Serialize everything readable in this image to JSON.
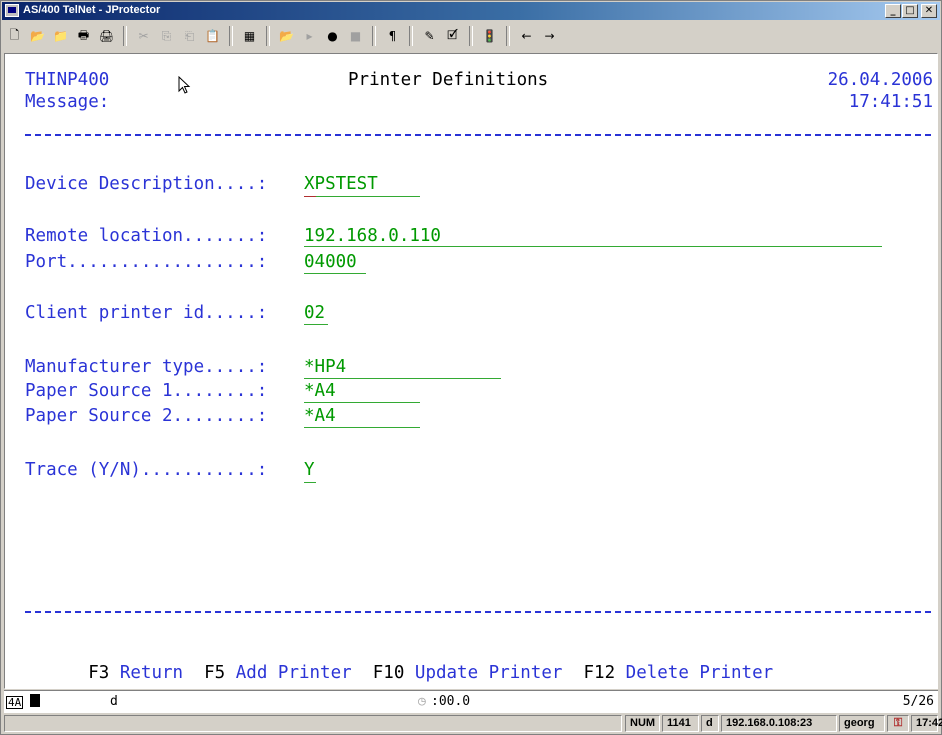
{
  "window": {
    "title": "AS/400 TelNet - JProtector",
    "minimize": "_",
    "maximize": "□",
    "close": "✕"
  },
  "toolbar": {
    "buttons": [
      {
        "icon": "new-document-icon",
        "glyph": "🗋"
      },
      {
        "icon": "open-folder-icon",
        "glyph": "📂"
      },
      {
        "icon": "open-session-icon",
        "glyph": "📁"
      },
      {
        "icon": "print-icon",
        "glyph": "🖶"
      },
      {
        "icon": "print-screen-icon",
        "glyph": "🖨"
      },
      {
        "icon": "cut-icon",
        "glyph": "✂"
      },
      {
        "icon": "copy-icon",
        "glyph": "⎘"
      },
      {
        "icon": "copy-append-icon",
        "glyph": "⎗"
      },
      {
        "icon": "paste-icon",
        "glyph": "📋"
      },
      {
        "icon": "keypad-icon",
        "glyph": "▦"
      },
      {
        "icon": "open-macro-icon",
        "glyph": "📂"
      },
      {
        "icon": "play-icon",
        "glyph": "▸"
      },
      {
        "icon": "record-icon",
        "glyph": "●"
      },
      {
        "icon": "stop-icon",
        "glyph": "■"
      },
      {
        "icon": "paragraph-icon",
        "glyph": "¶"
      },
      {
        "icon": "edit-pencil-icon",
        "glyph": "✎"
      },
      {
        "icon": "edit-settings-icon",
        "glyph": "🗹"
      },
      {
        "icon": "traffic-light-icon",
        "glyph": "🚦"
      },
      {
        "icon": "arrow-left-icon",
        "glyph": "←"
      },
      {
        "icon": "arrow-right-icon",
        "glyph": "→"
      }
    ]
  },
  "screen": {
    "program": "THINP400",
    "title": "Printer Definitions",
    "date": "26.04.2006",
    "message_label": "Message:",
    "time": "17:41:51",
    "fields": {
      "device_description": {
        "label": "Device Description....:",
        "value": "XPSTEST"
      },
      "remote_location": {
        "label": "Remote location.......:",
        "value": "192.168.0.110"
      },
      "port": {
        "label": "Port..................:",
        "value": "04000"
      },
      "client_printer_id": {
        "label": "Client printer id.....:",
        "value": "02"
      },
      "manufacturer_type": {
        "label": "Manufacturer type.....:",
        "value": "*HP4"
      },
      "paper_source_1": {
        "label": "Paper Source 1........:",
        "value": "*A4"
      },
      "paper_source_2": {
        "label": "Paper Source 2........:",
        "value": "*A4"
      },
      "trace": {
        "label": "Trace (Y/N)...........:",
        "value": "Y"
      }
    },
    "function_keys": [
      {
        "key": "F3",
        "label": "Return"
      },
      {
        "key": "F5",
        "label": "Add Printer"
      },
      {
        "key": "F10",
        "label": "Update Printer"
      },
      {
        "key": "F12",
        "label": "Delete Printer"
      }
    ]
  },
  "oia": {
    "indicator": "4A",
    "mode": "d",
    "timer": ":00.0",
    "cursor_pos": "5/26"
  },
  "statusbar": {
    "num": "NUM",
    "session_no": "1141",
    "mode": "d",
    "host": "192.168.0.108:23",
    "user": "georg",
    "time": "17:42"
  }
}
